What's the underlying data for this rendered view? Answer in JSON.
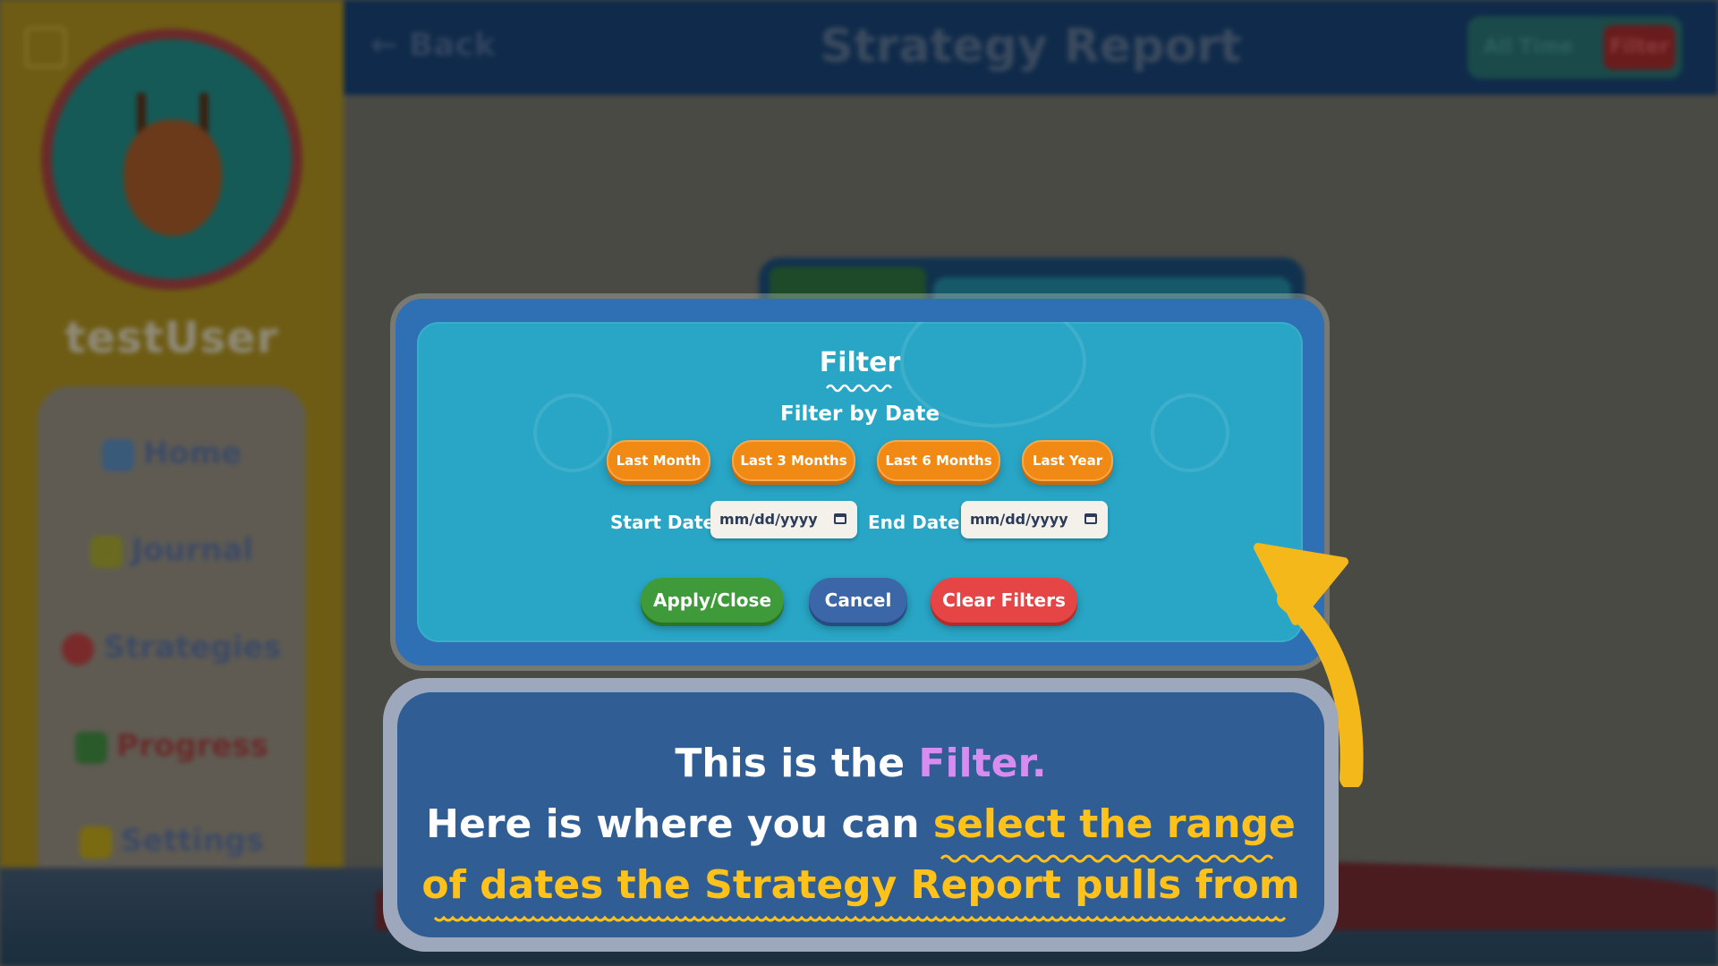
{
  "app": {
    "username": "testUser",
    "nav": [
      {
        "label": "Home",
        "icon": "home-icon"
      },
      {
        "label": "Journal",
        "icon": "pencil-icon"
      },
      {
        "label": "Strategies",
        "icon": "brain-icon"
      },
      {
        "label": "Progress",
        "icon": "bar-chart-icon"
      },
      {
        "label": "Settings",
        "icon": "gear-icon"
      }
    ],
    "header": {
      "back_label": "Back",
      "title": "Strategy Report",
      "toggle_all": "All Time",
      "toggle_filter": "Filter"
    }
  },
  "filter_modal": {
    "title": "Filter",
    "subtitle": "Filter by Date",
    "presets": [
      "Last Month",
      "Last 3 Months",
      "Last 6 Months",
      "Last Year"
    ],
    "start_label": "Start Date:",
    "end_label": "End Date:",
    "start_placeholder": "mm/dd/yyyy",
    "end_placeholder": "mm/dd/yyyy",
    "apply_label": "Apply/Close",
    "cancel_label": "Cancel",
    "clear_label": "Clear Filters"
  },
  "tutorial": {
    "line1_a": "This is the ",
    "line1_b": "Filter.",
    "line2_a": "Here is where you can ",
    "line2_b": "select the range",
    "line3": "of dates the Strategy Report pulls from"
  },
  "colors": {
    "accent_yellow": "#ffc21a",
    "accent_purple": "#d98cf0",
    "modal_teal": "#29a6c6",
    "preset_orange": "#f08a14",
    "apply_green": "#3f9a3a",
    "cancel_blue": "#3b66a8",
    "clear_red": "#e54545"
  }
}
